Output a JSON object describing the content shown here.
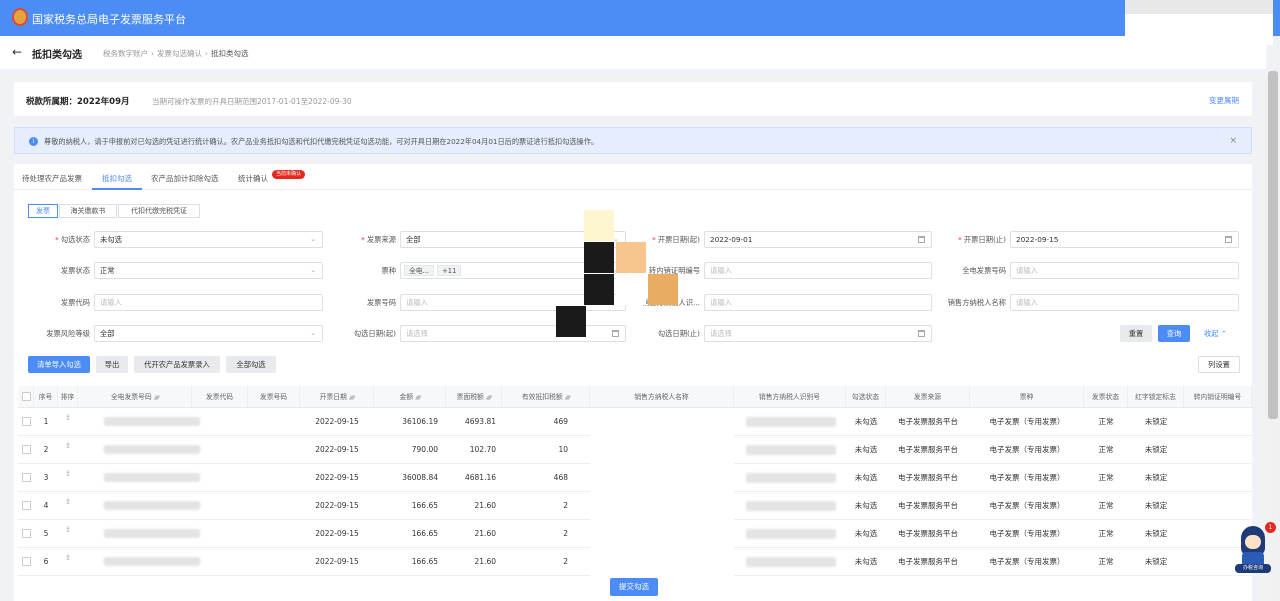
{
  "header": {
    "title": "国家税务总局电子发票服务平台"
  },
  "page": {
    "title": "抵扣类勾选",
    "breadcrumb": [
      "税务数字账户",
      "发票勾选确认",
      "抵扣类勾选"
    ]
  },
  "period": {
    "label": "税款所属期：2022年09月",
    "hint": "当期可操作发票的开具日期范围2017-01-01至2022-09-30",
    "change_link": "变更属期"
  },
  "notice": {
    "icon": "info-icon",
    "text": "尊敬的纳税人，请于申报前对已勾选的凭证进行统计确认。农产品业务抵扣勾选和代扣代缴完税凭证勾选功能，可对开具日期在2022年04月01日后的票证进行抵扣勾选操作。",
    "close": "×"
  },
  "tabs": [
    {
      "label": "待处理农产品发票"
    },
    {
      "label": "抵扣勾选"
    },
    {
      "label": "农产品加计扣除勾选"
    },
    {
      "label": "统计确认"
    }
  ],
  "tab_badge": "当前未确认",
  "subtabs": [
    {
      "label": "发票"
    },
    {
      "label": "海关缴款书"
    },
    {
      "label": "代扣代缴完税凭证"
    }
  ],
  "filters": {
    "check_status": {
      "label": "勾选状态",
      "value": "未勾选"
    },
    "invoice_source": {
      "label": "发票来源",
      "value": "全部"
    },
    "issue_start": {
      "label": "开票日期(起)",
      "value": "2022-09-01"
    },
    "issue_end": {
      "label": "开票日期(止)",
      "value": "2022-09-15"
    },
    "invoice_status": {
      "label": "发票状态",
      "value": "正常"
    },
    "ticket_type": {
      "label": "票种",
      "tag1": "全电...",
      "tag2": "+11"
    },
    "transfer_cert_no": {
      "label": "转内销证明编号",
      "placeholder": "请输入"
    },
    "full_invoice_no": {
      "label": "全电发票号码",
      "placeholder": "请输入"
    },
    "invoice_code": {
      "label": "发票代码",
      "placeholder": "请输入"
    },
    "invoice_number": {
      "label": "发票号码",
      "placeholder": "请输入"
    },
    "seller_tax_id": {
      "label": "销售方纳税人识...",
      "placeholder": "请输入"
    },
    "seller_name": {
      "label": "销售方纳税人名称",
      "placeholder": "请输入"
    },
    "risk_level": {
      "label": "发票风险等级",
      "value": "全部"
    },
    "check_date_start": {
      "label": "勾选日期(起)",
      "placeholder": "请选择"
    },
    "check_date_end": {
      "label": "勾选日期(止)",
      "placeholder": "请选择"
    }
  },
  "actions": {
    "reset": "重置",
    "query": "查询",
    "collapse": "收起 ⌃",
    "import_check": "清单导入勾选",
    "export": "导出",
    "agri_entry": "代开农产品发票录入",
    "check_all": "全部勾选",
    "column_settings": "列设置",
    "submit": "提交勾选"
  },
  "table": {
    "columns": [
      "序号",
      "排序",
      "全电发票号码",
      "发票代码",
      "发票号码",
      "开票日期",
      "金额",
      "票面税额",
      "有效抵扣税额",
      "销售方纳税人名称",
      "销售方纳税人识别号",
      "勾选状态",
      "发票来源",
      "票种",
      "发票状态",
      "红字锁定标志",
      "转内销证明编号"
    ],
    "sortable": [
      "全电发票号码",
      "开票日期",
      "金额",
      "票面税额",
      "有效抵扣税额"
    ],
    "rows": [
      {
        "no": "1",
        "date": "2022-09-15",
        "amount": "36106.19",
        "tax": "4693.81",
        "valid_tax": "469",
        "check": "未勾选",
        "source": "电子发票服务平台",
        "type": "电子发票（专用发票）",
        "status": "正常",
        "lock": "未锁定"
      },
      {
        "no": "2",
        "date": "2022-09-15",
        "amount": "790.00",
        "tax": "102.70",
        "valid_tax": "10",
        "check": "未勾选",
        "source": "电子发票服务平台",
        "type": "电子发票（专用发票）",
        "status": "正常",
        "lock": "未锁定"
      },
      {
        "no": "3",
        "date": "2022-09-15",
        "amount": "36008.84",
        "tax": "4681.16",
        "valid_tax": "468",
        "check": "未勾选",
        "source": "电子发票服务平台",
        "type": "电子发票（专用发票）",
        "status": "正常",
        "lock": "未锁定"
      },
      {
        "no": "4",
        "date": "2022-09-15",
        "amount": "166.65",
        "tax": "21.60",
        "valid_tax": "2",
        "check": "未勾选",
        "source": "电子发票服务平台",
        "type": "电子发票（专用发票）",
        "status": "正常",
        "lock": "未锁定"
      },
      {
        "no": "5",
        "date": "2022-09-15",
        "amount": "166.65",
        "tax": "21.60",
        "valid_tax": "2",
        "check": "未勾选",
        "source": "电子发票服务平台",
        "type": "电子发票（专用发票）",
        "status": "正常",
        "lock": "未锁定"
      },
      {
        "no": "6",
        "date": "2022-09-15",
        "amount": "166.65",
        "tax": "21.60",
        "valid_tax": "2",
        "check": "未勾选",
        "source": "电子发票服务平台",
        "type": "电子发票（专用发票）",
        "status": "正常",
        "lock": "未锁定"
      }
    ]
  },
  "assistant": {
    "label": "办税咨询",
    "count": "1"
  },
  "colors": {
    "primary": "#4b8cf5",
    "danger": "#e6281f",
    "notice_bg": "#e4eefc"
  }
}
